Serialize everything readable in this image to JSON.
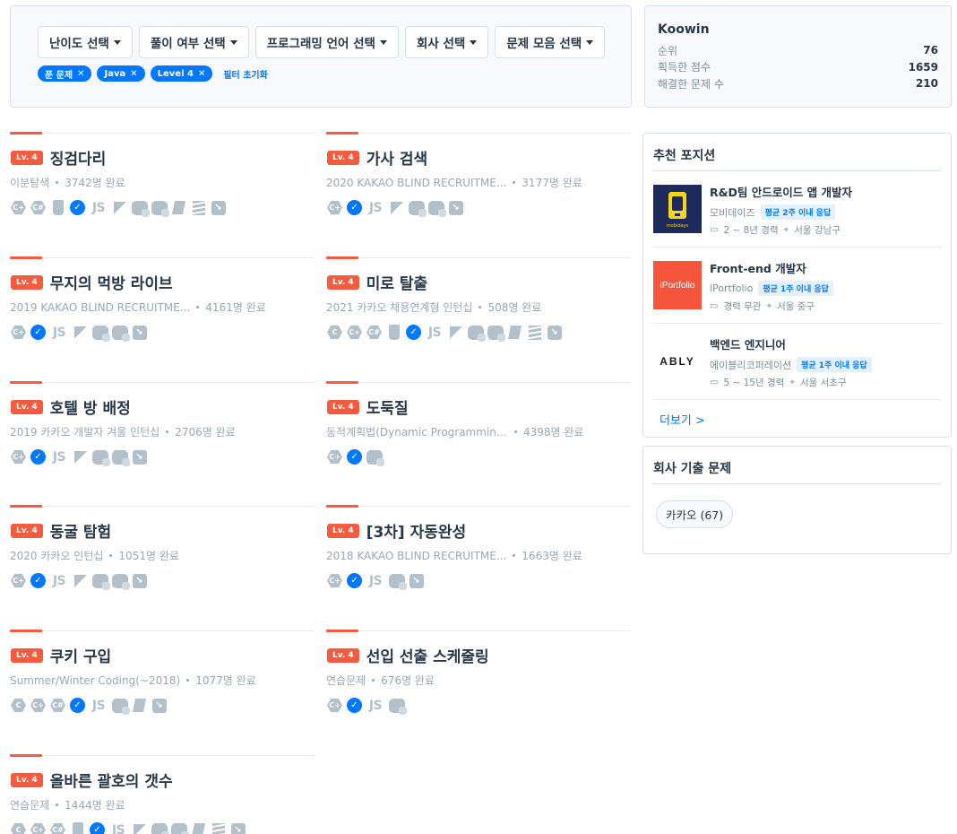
{
  "filters": {
    "dropdowns": [
      {
        "label": "난이도 선택"
      },
      {
        "label": "풀이 여부 선택"
      },
      {
        "label": "프로그래밍 언어 선택"
      },
      {
        "label": "회사 선택"
      },
      {
        "label": "문제 모음 선택"
      }
    ],
    "chips": [
      {
        "label": "푼 문제"
      },
      {
        "label": "Java"
      },
      {
        "label": "Level 4"
      }
    ],
    "reset_label": "필터 초기화"
  },
  "user": {
    "name": "Koowin",
    "stats": [
      {
        "label": "순위",
        "value": "76"
      },
      {
        "label": "획득한 점수",
        "value": "1659"
      },
      {
        "label": "해결한 문제 수",
        "value": "210"
      }
    ]
  },
  "problems": [
    {
      "level": "Lv. 4",
      "title": "징검다리",
      "category": "이분탐색",
      "completed": "3742명 완료",
      "languages": [
        "cpp",
        "csharp",
        "java",
        "check",
        "js",
        "kotlin",
        "python2",
        "python3",
        "ruby",
        "scala",
        "swift"
      ]
    },
    {
      "level": "Lv. 4",
      "title": "가사 검색",
      "category": "2020 KAKAO BLIND RECRUITME...",
      "completed": "3177명 완료",
      "languages": [
        "cpp",
        "check",
        "js",
        "kotlin",
        "python2",
        "python3",
        "swift"
      ]
    },
    {
      "level": "Lv. 4",
      "title": "무지의 먹방 라이브",
      "category": "2019 KAKAO BLIND RECRUITME...",
      "completed": "4161명 완료",
      "languages": [
        "cpp",
        "check",
        "js",
        "kotlin",
        "python2",
        "python3",
        "swift"
      ]
    },
    {
      "level": "Lv. 4",
      "title": "미로 탈출",
      "category": "2021 카카오 채용연계형 인턴십",
      "completed": "508명 완료",
      "languages": [
        "c",
        "cpp",
        "csharp",
        "java",
        "check",
        "js",
        "kotlin",
        "python2",
        "python3",
        "ruby",
        "scala",
        "swift"
      ]
    },
    {
      "level": "Lv. 4",
      "title": "호텔 방 배정",
      "category": "2019 카카오 개발자 겨울 인턴십",
      "completed": "2706명 완료",
      "languages": [
        "cpp",
        "check",
        "js",
        "kotlin",
        "python2",
        "python3",
        "swift"
      ]
    },
    {
      "level": "Lv. 4",
      "title": "도둑질",
      "category": "동적계획법(Dynamic Programming...",
      "completed": "4398명 완료",
      "languages": [
        "cpp",
        "check",
        "python3"
      ]
    },
    {
      "level": "Lv. 4",
      "title": "동굴 탐험",
      "category": "2020 카카오 인턴십",
      "completed": "1051명 완료",
      "languages": [
        "cpp",
        "check",
        "js",
        "kotlin",
        "python2",
        "python3",
        "swift"
      ]
    },
    {
      "level": "Lv. 4",
      "title": "[3차] 자동완성",
      "category": "2018 KAKAO BLIND RECRUITME...",
      "completed": "1663명 완료",
      "languages": [
        "cpp",
        "check",
        "js",
        "python3",
        "swift"
      ]
    },
    {
      "level": "Lv. 4",
      "title": "쿠키 구입",
      "category": "Summer/Winter Coding(~2018)",
      "completed": "1077명 완료",
      "languages": [
        "c",
        "cpp",
        "csharp",
        "check",
        "js",
        "python3",
        "ruby",
        "swift"
      ]
    },
    {
      "level": "Lv. 4",
      "title": "선입 선출 스케줄링",
      "category": "연습문제",
      "completed": "676명 완료",
      "languages": [
        "cpp",
        "check",
        "js",
        "python3"
      ]
    },
    {
      "level": "Lv. 4",
      "title": "올바른 괄호의 갯수",
      "category": "연습문제",
      "completed": "1444명 완료",
      "languages": [
        "c",
        "cpp",
        "csharp",
        "java",
        "check",
        "js",
        "kotlin",
        "python2",
        "python3",
        "ruby",
        "scala",
        "swift"
      ]
    }
  ],
  "jobs": {
    "title": "추천 포지션",
    "items": [
      {
        "name": "R&D팀 안드로이드 앱 개발자",
        "company": "모비데이즈",
        "reply": "평균 2주 이내 응답",
        "experience": "2 ~ 8년 경력",
        "location": "서울 강남구",
        "logo_text": "mobidays",
        "logo_color": "#1f2a5c"
      },
      {
        "name": "Front-end 개발자",
        "company": "iPortfolio",
        "reply": "평균 1주 이내 응답",
        "experience": "경력 무관",
        "location": "서울 중구",
        "logo_text": "iPortfolio",
        "logo_color": "#f4553b"
      },
      {
        "name": "백엔드 엔지니어",
        "company": "에이블리코퍼레이션",
        "reply": "평균 1주 이내 응답",
        "experience": "5 ~ 15년 경력",
        "location": "서울 서초구",
        "logo_text": "ABLY",
        "logo_color": "#ffffff"
      }
    ],
    "more_label": "더보기 >"
  },
  "company_problems": {
    "title": "회사 기출 문제",
    "tags": [
      {
        "label": "카카오 (67)"
      }
    ]
  },
  "colors": {
    "accent": "#f45b3f",
    "brand": "#0078ff",
    "text": "#263747",
    "muted": "#98a8b9"
  }
}
